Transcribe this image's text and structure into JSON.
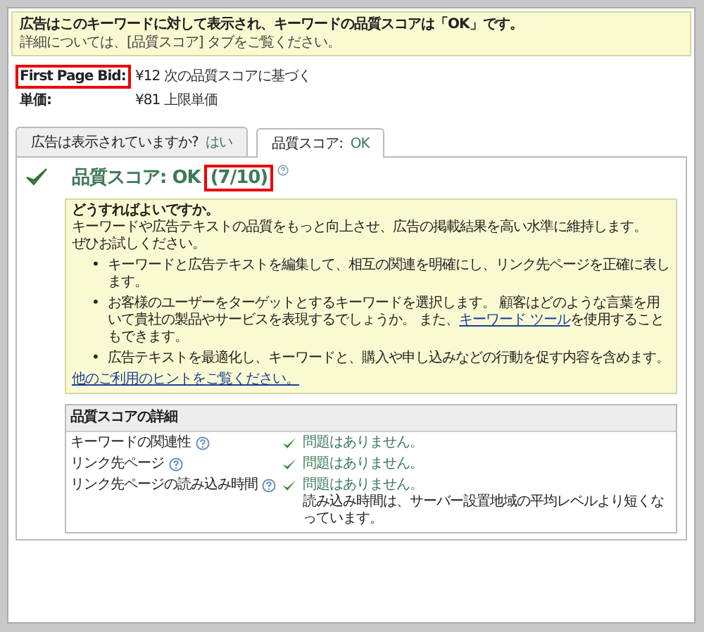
{
  "notice": {
    "lines": [
      "広告はこのキーワードに対して表示され、キーワードの品質スコアは「OK」です。",
      "詳細については、[品質スコア] タブをご覧ください。"
    ]
  },
  "bid_rows": [
    {
      "label": "First Page Bid:",
      "value": "¥12",
      "note": "次の品質スコアに基づく",
      "highlighted": true
    },
    {
      "label": "単価:",
      "value": "¥81",
      "note": "上限単価",
      "highlighted": false
    }
  ],
  "tabs": [
    {
      "label": "広告は表示されていますか?",
      "status": "はい",
      "selected": false
    },
    {
      "label": "品質スコア:",
      "status": "OK",
      "selected": true
    }
  ],
  "score": {
    "title": "品質スコア: OK",
    "fraction": "(7/10)",
    "highlighted": true
  },
  "tips": {
    "heading": "どうすればよいですか。",
    "intro": [
      "キーワードや広告テキストの品質をもっと向上させ、広告の掲載結果を高い水準に維持します。",
      "ぜひお試しください。"
    ],
    "bullet": "•",
    "bullets": [
      [
        {
          "kind": "text",
          "text": "キーワードと広告テキストを編集して、相互の関連を明確にし、リンク先ページを正確に表します。"
        }
      ],
      [
        {
          "kind": "text",
          "text": "お客様のユーザーをターゲットとするキーワードを選択します。 顧客はどのような言葉を用いて貴社の製品やサービスを表現するでしょうか。 また、"
        },
        {
          "kind": "link",
          "text": "キーワード ツール"
        },
        {
          "kind": "text",
          "text": "を使用することもできます。"
        }
      ],
      [
        {
          "kind": "text",
          "text": "広告テキストを最適化し、キーワードと、購入や申し込みなどの行動を促す内容を含めます。"
        }
      ]
    ],
    "link": "他のご利用のヒントをご覧ください。"
  },
  "details": {
    "title": "品質スコアの詳細",
    "rows": [
      {
        "label": "キーワードの関連性",
        "status": "問題はありません。"
      },
      {
        "label": "リンク先ページ",
        "status": "問題はありません。"
      },
      {
        "label": "リンク先ページの読み込み時間",
        "status": "問題はありません。",
        "note": "読み込み時間は、サーバー設置地域の平均レベルより短くなっています。"
      }
    ]
  }
}
